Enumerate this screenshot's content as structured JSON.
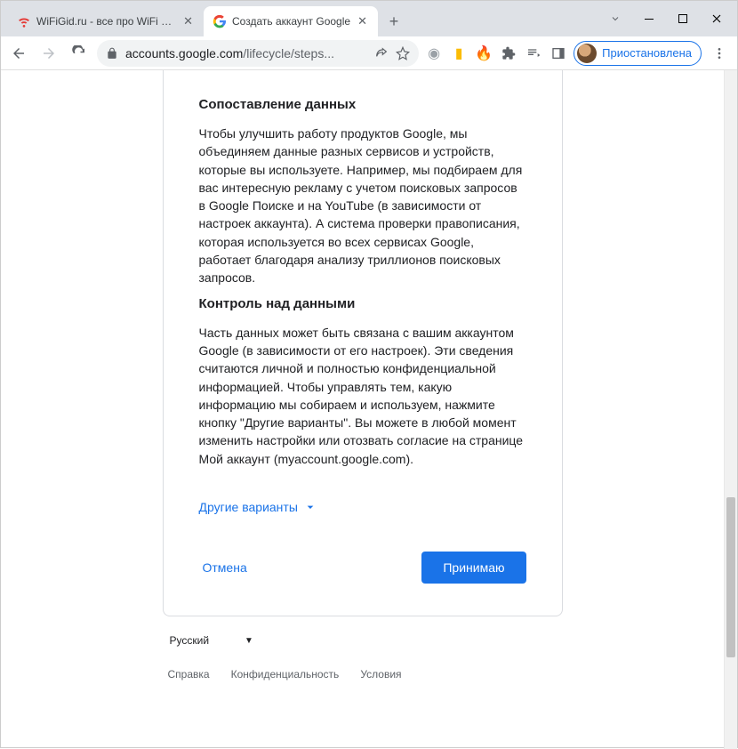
{
  "tabs": [
    {
      "title": "WiFiGid.ru - все про WiFi и бесп"
    },
    {
      "title": "Создать аккаунт Google"
    }
  ],
  "address": {
    "domain": "accounts.google.com",
    "path": "/lifecycle/steps..."
  },
  "profile": {
    "label": "Приостановлена"
  },
  "content": {
    "h1": "Сопоставление данных",
    "p1": "Чтобы улучшить работу продуктов Google, мы объединяем данные разных сервисов и устройств, которые вы используете. Например, мы подбираем для вас интересную рекламу с учетом поисковых запросов в Google Поиске и на YouTube (в зависимости от настроек аккаунта). А система проверки правописания, которая используется во всех сервисах Google, работает благодаря анализу триллионов поисковых запросов.",
    "h2": "Контроль над данными",
    "p2": "Часть данных может быть связана с вашим аккаунтом Google (в зависимости от его настроек). Эти сведения считаются личной и полностью конфиденциальной информацией. Чтобы управлять тем, какую информацию мы собираем и используем, нажмите кнопку \"Другие варианты\". Вы можете в любой момент изменить настройки или отозвать согласие на странице Мой аккаунт (myaccount.google.com).",
    "more": "Другие варианты",
    "cancel": "Отмена",
    "accept": "Принимаю"
  },
  "footer": {
    "language": "Русский",
    "links": [
      "Справка",
      "Конфиденциальность",
      "Условия"
    ]
  }
}
